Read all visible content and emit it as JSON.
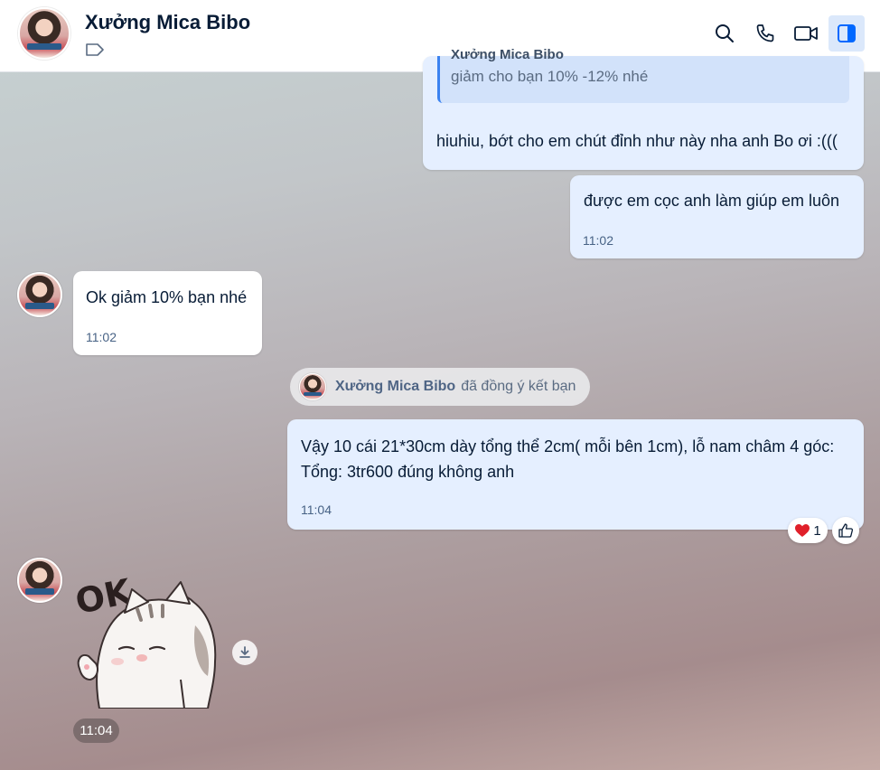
{
  "header": {
    "title": "Xưởng Mica Bibo",
    "avatar": "contact-avatar",
    "icons": [
      "tag-icon",
      "search-icon",
      "phone-icon",
      "video-icon",
      "sidebar-toggle-icon"
    ]
  },
  "messages": [
    {
      "sender": "me",
      "quote_name": "Xưởng Mica Bibo",
      "quote_text": "giảm cho bạn 10% -12% nhé",
      "text": "hiuhiu, bớt cho em chút đỉnh như này nha anh Bo ơi :((("
    },
    {
      "sender": "me",
      "text": "được em cọc anh làm giúp em luôn",
      "time": "11:02"
    },
    {
      "sender": "them",
      "text": "Ok giảm 10% bạn nhé",
      "time": "11:02"
    },
    {
      "sender": "system",
      "name": "Xưởng Mica Bibo",
      "text": "đã đồng ý kết bạn"
    },
    {
      "sender": "me",
      "text_line1": "Vậy 10 cái 21*30cm dày tổng thể 2cm( mỗi bên 1cm), lỗ nam châm 4 góc:",
      "text_line2": "Tổng: 3tr600 đúng không anh",
      "time": "11:04",
      "reaction_count": "1",
      "reaction_icon": "heart-icon"
    },
    {
      "sender": "them",
      "sticker_text": "OK",
      "time": "11:04"
    }
  ],
  "colors": {
    "my_bubble": "#e5efff",
    "their_bubble": "#ffffff",
    "accent": "#0068ff",
    "quote_bar": "#3b82f0"
  }
}
